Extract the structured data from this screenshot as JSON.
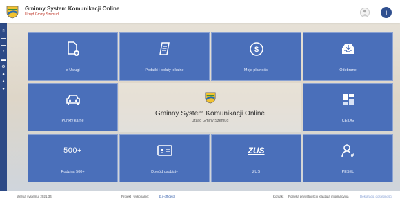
{
  "header": {
    "app_title": "Gminny System Komunikacji Online",
    "app_subtitle": "Urząd Gminy Szemud",
    "user_icon": "user-icon",
    "info_icon": "info-icon",
    "info_symbol": "i"
  },
  "sidebar": {
    "items": [
      {
        "icon": "document-icon",
        "glyph": "▯"
      },
      {
        "icon": "printer-icon",
        "glyph": "▬"
      },
      {
        "icon": "car-icon",
        "glyph": "▬"
      },
      {
        "icon": "edit-icon",
        "glyph": "/"
      },
      {
        "icon": "card-icon",
        "glyph": "▬"
      },
      {
        "icon": "gear-icon",
        "glyph": "⚙"
      },
      {
        "icon": "pin-icon",
        "glyph": "●"
      },
      {
        "icon": "person-icon",
        "glyph": "▲"
      },
      {
        "icon": "info-icon",
        "glyph": "●"
      }
    ]
  },
  "tiles": [
    {
      "label": "e-Usługi",
      "icon": "document-add-icon"
    },
    {
      "label": "Podatki i opłaty lokalne",
      "icon": "receipt-icon"
    },
    {
      "label": "Moje płatności",
      "icon": "dollar-coin-icon"
    },
    {
      "label": "Odebrane",
      "icon": "inbox-icon"
    },
    {
      "label": "Punkty karne",
      "icon": "car-icon"
    },
    {
      "label": "CEIDG",
      "icon": "building-blocks-icon"
    },
    {
      "label": "Rodzina 500+",
      "icon": "family-500-icon",
      "icon_text": "500+"
    },
    {
      "label": "Dowód osobisty",
      "icon": "id-card-icon"
    },
    {
      "label": "ZUS",
      "icon": "zus-logo-icon",
      "icon_text": "ZUS"
    },
    {
      "label": "PESEL",
      "icon": "pesel-person-icon"
    }
  ],
  "center": {
    "title": "Gminny System Komunikacji Online",
    "subtitle": "Urząd Gminy Szemud"
  },
  "footer": {
    "version": "Wersja systemu: 2021.34",
    "provider_label": "Projekt i wykonanie:",
    "provider_link": "ib.it-office.pl",
    "contact": "Kontakt",
    "privacy": "Polityka prywatności i klauzula informacyjna",
    "accessibility": "Deklaracja dostępności"
  },
  "colors": {
    "tile": "#4a6fba",
    "sidebar": "#2d4a86",
    "accent": "#2f4f8f"
  }
}
